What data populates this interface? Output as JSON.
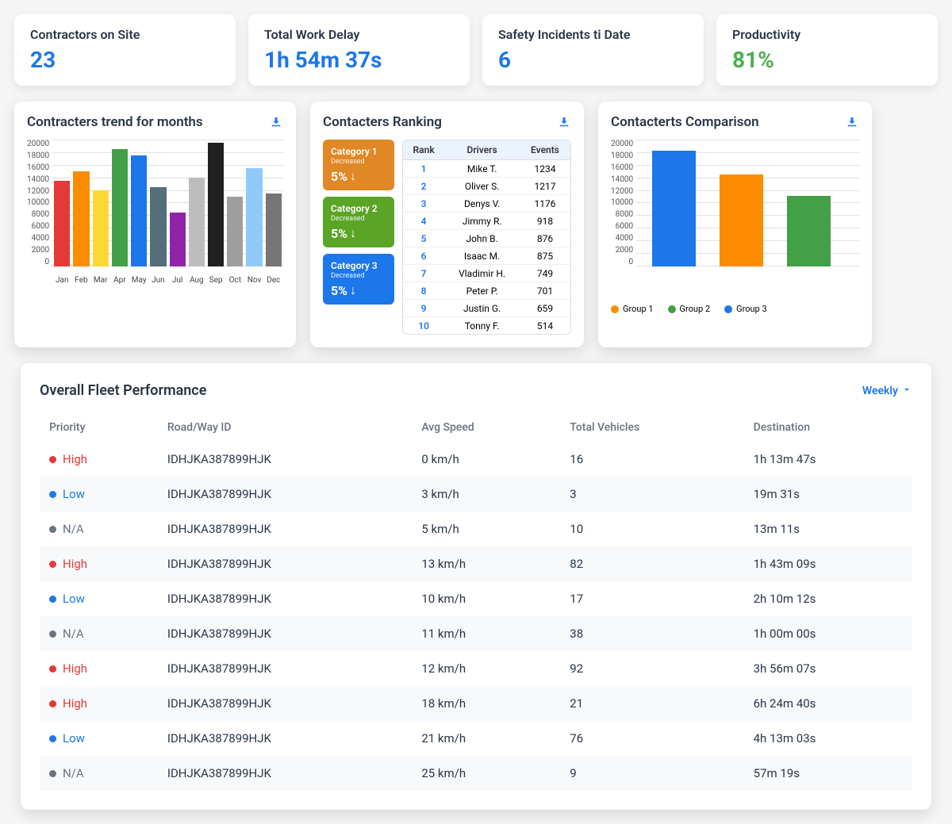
{
  "kpis": [
    {
      "label": "Contractors on Site",
      "value": "23",
      "color": "blue"
    },
    {
      "label": "Total Work Delay",
      "value": "1h 54m 37s",
      "color": "blue"
    },
    {
      "label": "Safety Incidents ti Date",
      "value": "6",
      "color": "blue"
    },
    {
      "label": "Productivity",
      "value": "81%",
      "color": "green"
    }
  ],
  "chart_data": [
    {
      "id": "trend",
      "type": "bar",
      "title": "Contracters trend for months",
      "categories": [
        "Jan",
        "Feb",
        "Mar",
        "Apr",
        "May",
        "Jun",
        "Jul",
        "Aug",
        "Sep",
        "Oct",
        "Nov",
        "Dec"
      ],
      "values": [
        13500,
        15000,
        12000,
        18500,
        17500,
        12500,
        8500,
        14000,
        19500,
        11000,
        15500,
        11500
      ],
      "colors": [
        "#E53935",
        "#FB8C00",
        "#FDD835",
        "#43A047",
        "#1C77EB",
        "#546E7A",
        "#8E24AA",
        "#BDBDBD",
        "#212121",
        "#9E9E9E",
        "#90CAF9",
        "#757575"
      ],
      "ylim": [
        0,
        20000
      ],
      "yticks": [
        0,
        2000,
        4000,
        6000,
        8000,
        10000,
        12000,
        14000,
        16000,
        18000,
        20000
      ]
    },
    {
      "id": "comparison",
      "type": "bar",
      "title": "Contacterts Comparison",
      "categories": [
        "Group 1",
        "Group 2",
        "Group 3"
      ],
      "values": [
        18800,
        15000,
        11500
      ],
      "colors": [
        "#1C77EB",
        "#FB8C00",
        "#43A047"
      ],
      "ylim": [
        0,
        20000
      ],
      "yticks": [
        0,
        2000,
        4000,
        6000,
        8000,
        10000,
        12000,
        14000,
        16000,
        18000,
        20000
      ],
      "legend": [
        {
          "label": "Group 1",
          "color": "#FB8C00"
        },
        {
          "label": "Group 2",
          "color": "#43A047"
        },
        {
          "label": "Group 3",
          "color": "#1C77EB"
        }
      ]
    }
  ],
  "ranking": {
    "title": "Contacters Ranking",
    "categories": [
      {
        "title": "Category  1",
        "sub": "Decreased",
        "pct": "5%",
        "class": "cat-orange"
      },
      {
        "title": "Category  2",
        "sub": "Decreased",
        "pct": "5%",
        "class": "cat-green"
      },
      {
        "title": "Category  3",
        "sub": "Decreased",
        "pct": "5%",
        "class": "cat-blue"
      }
    ],
    "headers": {
      "rank": "Rank",
      "drivers": "Drivers",
      "events": "Events"
    },
    "rows": [
      {
        "rank": "1",
        "driver": "Mike T.",
        "events": "1234"
      },
      {
        "rank": "2",
        "driver": "Oliver S.",
        "events": "1217"
      },
      {
        "rank": "3",
        "driver": "Denys V.",
        "events": "1176"
      },
      {
        "rank": "4",
        "driver": "Jimmy R.",
        "events": "918"
      },
      {
        "rank": "5",
        "driver": "John B.",
        "events": "876"
      },
      {
        "rank": "6",
        "driver": "Isaac M.",
        "events": "875"
      },
      {
        "rank": "7",
        "driver": "Vladimir H.",
        "events": "749"
      },
      {
        "rank": "8",
        "driver": "Peter P.",
        "events": "701"
      },
      {
        "rank": "9",
        "driver": "Justin G.",
        "events": "659"
      },
      {
        "rank": "10",
        "driver": "Tonny F.",
        "events": "514"
      }
    ]
  },
  "fleet": {
    "title": "Overall Fleet Performance",
    "dropdown": "Weekly",
    "headers": {
      "priority": "Priority",
      "road": "Road/Way ID",
      "speed": "Avg Speed",
      "vehicles": "Total Vehicles",
      "dest": "Destination"
    },
    "rows": [
      {
        "priority": "High",
        "pclass": "high",
        "road": "IDHJKA387899HJK",
        "speed": "0 km/h",
        "vehicles": "16",
        "dest": "1h 13m 47s"
      },
      {
        "priority": "Low",
        "pclass": "low",
        "road": "IDHJKA387899HJK",
        "speed": "3 km/h",
        "vehicles": "3",
        "dest": "19m 31s"
      },
      {
        "priority": "N/A",
        "pclass": "na",
        "road": "IDHJKA387899HJK",
        "speed": "5 km/h",
        "vehicles": "10",
        "dest": "13m 11s"
      },
      {
        "priority": "High",
        "pclass": "high",
        "road": "IDHJKA387899HJK",
        "speed": "13 km/h",
        "vehicles": "82",
        "dest": "1h 43m 09s"
      },
      {
        "priority": "Low",
        "pclass": "low",
        "road": "IDHJKA387899HJK",
        "speed": "10 km/h",
        "vehicles": "17",
        "dest": "2h 10m 12s"
      },
      {
        "priority": "N/A",
        "pclass": "na",
        "road": "IDHJKA387899HJK",
        "speed": "11 km/h",
        "vehicles": "38",
        "dest": "1h 00m 00s"
      },
      {
        "priority": "High",
        "pclass": "high",
        "road": "IDHJKA387899HJK",
        "speed": "12 km/h",
        "vehicles": "92",
        "dest": "3h 56m 07s"
      },
      {
        "priority": "High",
        "pclass": "high",
        "road": "IDHJKA387899HJK",
        "speed": "18 km/h",
        "vehicles": "21",
        "dest": "6h 24m 40s"
      },
      {
        "priority": "Low",
        "pclass": "low",
        "road": "IDHJKA387899HJK",
        "speed": "21 km/h",
        "vehicles": "76",
        "dest": "4h 13m 03s"
      },
      {
        "priority": "N/A",
        "pclass": "na",
        "road": "IDHJKA387899HJK",
        "speed": "25 km/h",
        "vehicles": "9",
        "dest": "57m 19s"
      }
    ]
  }
}
